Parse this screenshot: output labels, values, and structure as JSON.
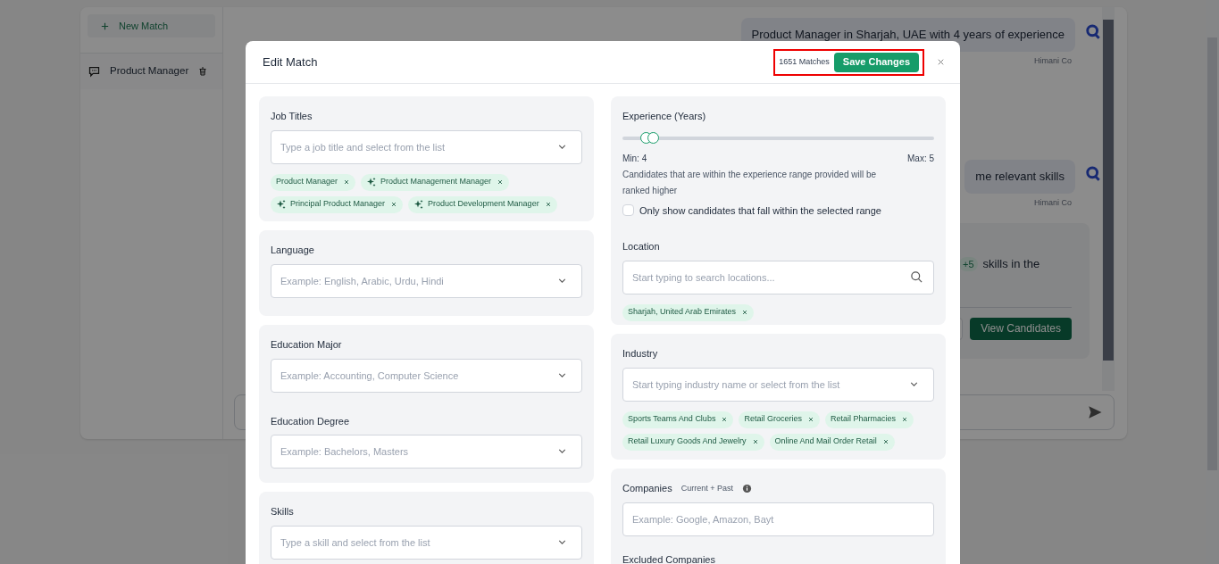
{
  "sidebar": {
    "new_button": "New Match",
    "items": [
      {
        "label": "Product Manager"
      }
    ]
  },
  "chat": {
    "messages": [
      {
        "text": "Product Manager in Sharjah, UAE with 4 years of experience",
        "sender": "Himani Co"
      },
      {
        "text": "me relevant skills",
        "sender": "Himani Co"
      }
    ],
    "card": {
      "badge": "+5",
      "text": "skills in the",
      "button": "View Candidates"
    }
  },
  "modal": {
    "title": "Edit Match",
    "match_count": "1651 Matches",
    "save_button": "Save Changes",
    "columns": [
      [
        {
          "kind": "fields",
          "fields": [
            {
              "label": "Job Titles",
              "kind": "dropdown",
              "placeholder": "Type a job title and select from the list",
              "chips": [
                {
                  "label": "Product Manager",
                  "ai": false
                },
                {
                  "label": "Product Management Manager",
                  "ai": true
                },
                {
                  "label": "Principal Product Manager",
                  "ai": true
                },
                {
                  "label": "Product Development Manager",
                  "ai": true
                }
              ]
            }
          ]
        },
        {
          "kind": "fields",
          "fields": [
            {
              "label": "Language",
              "kind": "dropdown",
              "placeholder": "Example: English, Arabic, Urdu, Hindi"
            }
          ]
        },
        {
          "kind": "fields",
          "fields": [
            {
              "label": "Education Major",
              "kind": "dropdown",
              "placeholder": "Example: Accounting, Computer Science"
            },
            {
              "label": "Education Degree",
              "kind": "dropdown",
              "placeholder": "Example: Bachelors, Masters"
            }
          ]
        },
        {
          "kind": "fields",
          "fields": [
            {
              "label": "Skills",
              "kind": "dropdown",
              "placeholder": "Type a skill and select from the list"
            }
          ]
        }
      ],
      [
        {
          "kind": "experience",
          "label": "Experience (Years)",
          "min_thumb": {
            "level": 0.075
          },
          "max_thumb": {
            "level": 0.097
          },
          "min_text": "Min: 4",
          "max_text": "Max: 5",
          "note": "Candidates that are within the experience range provided will be ranked higher",
          "checkbox": {
            "label": "Only show candidates that fall within the selected range",
            "checked": false
          },
          "fields": [
            {
              "label": "Location",
              "kind": "search",
              "placeholder": "Start typing to search locations...",
              "chips": [
                {
                  "label": "Sharjah, United Arab Emirates",
                  "ai": false
                }
              ]
            }
          ]
        },
        {
          "kind": "fields",
          "fields": [
            {
              "label": "Industry",
              "kind": "dropdown",
              "placeholder": "Start typing industry name or select from the list",
              "chips": [
                {
                  "label": "Sports Teams And Clubs",
                  "ai": false
                },
                {
                  "label": "Retail Groceries",
                  "ai": false
                },
                {
                  "label": "Retail Pharmacies",
                  "ai": false
                },
                {
                  "label": "Retail Luxury Goods And Jewelry",
                  "ai": false
                },
                {
                  "label": "Online And Mail Order Retail",
                  "ai": false
                }
              ]
            }
          ]
        },
        {
          "kind": "fields",
          "fields": [
            {
              "label": "Companies",
              "sublabel": "Current + Past",
              "info": true,
              "kind": "text",
              "placeholder": "Example: Google, Amazon, Bayt"
            },
            {
              "label": "Excluded Companies"
            }
          ]
        }
      ]
    ]
  }
}
